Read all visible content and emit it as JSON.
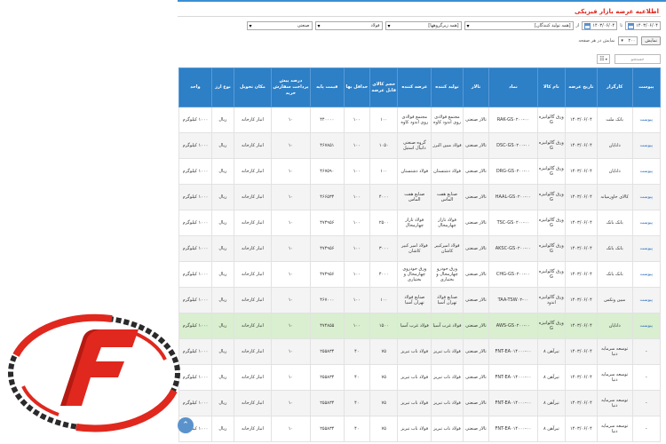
{
  "page": {
    "title": "اطلاعیه عرضه بازار فیزیکی"
  },
  "filters": {
    "market": "صنعتی",
    "product": "فولاد",
    "subgroup": "[همه زیرگروهها]",
    "producer": "[همه تولید کنندگان]",
    "date_from_label": "از",
    "date_from": "۱۴۰۳/۰۶/۰۴",
    "date_to_label": "تا",
    "date_to": "۱۴۰۳/۰۶/۰۴"
  },
  "paging": {
    "label": "نمایش در هر صفحه",
    "per_page": "۲۰۰",
    "show_button": "نمایش"
  },
  "search": {
    "placeholder": "جستجو"
  },
  "table": {
    "headers": [
      "پیوست",
      "کارگزار",
      "تاریخ عرضه",
      "نام کالا",
      "نماد",
      "تالار",
      "تولید کننده",
      "عرضه کننده",
      "حجم کالای قابل عرضه",
      "حداقل بها",
      "قیمت پایه",
      "درصد پیش پرداخت سفارش خرید",
      "مکان تحویل",
      "نوع ارز",
      "واحد"
    ],
    "rows": [
      [
        "پیوست",
        "بانک ملت",
        "۱۴۰۳/۰۶/۰۴",
        "ورق گالوانیزه G",
        "RAK-GS۰۲۰۰-۰۰",
        "تالار صنعتی",
        "مجتمع فولادی روی اندود کاوه",
        "مجتمع فولادی روی اندود کاوه",
        "۱۰۰",
        "۱۰۰",
        "۴۴۰۰۰۰",
        "۱۰",
        "انبار کارخانه",
        "ریال",
        "۱۰۰۰ کیلوگرم"
      ],
      [
        "پیوست",
        "دانایان",
        "۱۴۰۳/۰۶/۰۴",
        "ورق گالوانیزه G",
        "DSC-GS۰۲۰۰-۰۰",
        "تالار صنعتی",
        "فولاد مبین البرز",
        "گروه صنعتی دانیال استیل",
        "۱۰۵۰",
        "۱۰۰",
        "۴۶۷۸۵۱",
        "۱۰",
        "انبار کارخانه",
        "ریال",
        "۱۰۰۰ کیلوگرم"
      ],
      [
        "پیوست",
        "دانایان",
        "۱۴۰۳/۰۶/۰۴",
        "ورق گالوانیزه G",
        "DRG-GS۰۲۰۰-۰۰",
        "تالار صنعتی",
        "فولاد دشتستان",
        "فولاد دشتستان",
        "۱۰۰",
        "۱۰۰",
        "۴۶۷۵۹۰",
        "۱۰",
        "انبار کارخانه",
        "ریال",
        "۱۰۰۰ کیلوگرم"
      ],
      [
        "پیوست",
        "کالای خاورمیانه",
        "۱۴۰۳/۰۶/۰۴",
        "ورق گالوانیزه G",
        "HAAL-GS۰۲۰۰-۰۰",
        "تالار صنعتی",
        "صنایع هفت الماس",
        "صنایع هفت الماس",
        "۴۰۰۰",
        "۱۰۰",
        "۴۶۶۵۳۴",
        "۱۰",
        "انبار کارخانه",
        "ریال",
        "۱۰۰۰ کیلوگرم"
      ],
      [
        "پیوست",
        "بانک بانک",
        "۱۴۰۳/۰۶/۰۴",
        "ورق گالوانیزه G",
        "TSC-GS۰۲۰۰-۰۰",
        "تالار صنعتی",
        "فولاد تاراز چهارمحال",
        "فولاد تاراز چهارمحال",
        "۲۵۰۰",
        "۱۰۰",
        "۴۷۴۹۵۶",
        "۱۰",
        "انبار کارخانه",
        "ریال",
        "۱۰۰۰ کیلوگرم"
      ],
      [
        "پیوست",
        "بانک بانک",
        "۱۴۰۳/۰۶/۰۴",
        "ورق گالوانیزه G",
        "AKSC-GS۰۲۰۰-۰۰",
        "تالار صنعتی",
        "فولاد امیرکبیر کاشان",
        "فولاد امیر کبیر کاشان",
        "۳۰۰۰",
        "۱۰۰",
        "۴۷۴۹۵۶",
        "۱۰",
        "انبار کارخانه",
        "ریال",
        "۱۰۰۰ کیلوگرم"
      ],
      [
        "پیوست",
        "بانک بانک",
        "۱۴۰۳/۰۶/۰۴",
        "ورق گالوانیزه G",
        "CHG-GS۰۲۰۰-۰۰",
        "تالار صنعتی",
        "ورق خودرو چهارمحال و بختیاری",
        "ورق خودروی چهارمحال و بختیاری",
        "۴۰۰۰",
        "۱۰۰",
        "۴۷۴۹۵۶",
        "۱۰",
        "انبار کارخانه",
        "ریال",
        "۱۰۰۰ کیلوگرم"
      ],
      [
        "پیوست",
        "مبین وتکس",
        "۱۴۰۳/۰۶/۰۴",
        "ورق گالوانیزه اندود",
        "TAA-TSW۰۲-۰۰",
        "تالار صنعتی",
        "صنایع فولاد تهران آسیا",
        "صنایع فولاد تهران آسیا",
        "۱۰۰",
        "۱۰۰",
        "۴۶۷۰۰۰",
        "۱۰",
        "انبار کارخانه",
        "ریال",
        "۱۰۰۰ کیلوگرم"
      ],
      [
        "پیوست",
        "دانایان",
        "۱۴۰۳/۰۶/۰۴",
        "ورق گالوانیزه G",
        "AWS-GS۰۲۰۰-۰۰",
        "تالار صنعتی",
        "فولاد غرب آسیا",
        "فولاد غرب آسیا",
        "۱۵۰۰",
        "۱۰۰",
        "۴۷۴۸۵۵",
        "۱۰",
        "انبار کارخانه",
        "ریال",
        "۱۰۰۰ کیلوگرم"
      ],
      [
        "-",
        "توسعه سرمایه دنیا",
        "۱۴۰۳/۰۶/۰۴",
        "تیرآهن ۸",
        "FNT-EA۰۱۴۰۰۰-۰۰",
        "تالار صنعتی",
        "فولاد ناب تبریز",
        "فولاد ناب تبریز",
        "۷۵",
        "۴۰",
        "۲۵۵۸۳۴",
        "۱۰",
        "انبار کارخانه",
        "ریال",
        "۱۰۰۰ کیلوگرم"
      ],
      [
        "-",
        "توسعه سرمایه دنیا",
        "۱۴۰۳/۰۶/۰۴",
        "تیرآهن ۸",
        "FNT-EA۰۱۴۰۰۰-۰۰",
        "تالار صنعتی",
        "فولاد ناب تبریز",
        "فولاد ناب تبریز",
        "۷۵",
        "۴۰",
        "۲۵۵۸۳۴",
        "۱۰",
        "انبار کارخانه",
        "ریال",
        "۱۰۰۰ کیلوگرم"
      ],
      [
        "-",
        "توسعه سرمایه دنیا",
        "۱۴۰۳/۰۶/۰۴",
        "تیرآهن ۸",
        "FNT-EA۰۱۴۰۰۰-۰۰",
        "تالار صنعتی",
        "فولاد ناب تبریز",
        "فولاد ناب تبریز",
        "۷۵",
        "۴۰",
        "۲۵۵۸۳۴",
        "۱۰",
        "انبار کارخانه",
        "ریال",
        "۱۰۰۰ کیلوگرم"
      ],
      [
        "-",
        "توسعه سرمایه دنیا",
        "۱۴۰۳/۰۶/۰۴",
        "تیرآهن ۸",
        "FNT-EA۰۱۴۰۰۰-۰۰",
        "تالار صنعتی",
        "فولاد ناب تبریز",
        "فولاد ناب تبریز",
        "۷۵",
        "۴۰",
        "۲۵۵۸۳۴",
        "۱۰",
        "انبار کارخانه",
        "ریال",
        "۱۰۰۰ کیلوگرم"
      ]
    ],
    "highlight_row": 8
  },
  "colors": {
    "header": "#2d7fc6",
    "highlight": "#d9efd0",
    "title": "#e0281e",
    "logo_red": "#e0281e",
    "logo_dark": "#2a2a2a"
  },
  "icons": {
    "logo": "f-logo",
    "calendar": "calendar-icon",
    "scroll": "arrow-up-icon"
  }
}
